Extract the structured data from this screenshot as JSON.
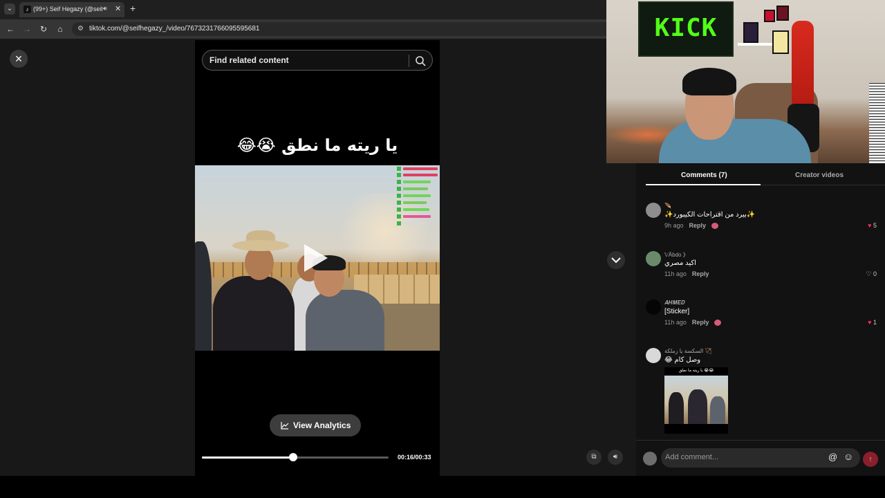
{
  "browser": {
    "tab_title": "(99+) Seif Hegazy (@seifheg",
    "tab_favicon": "tiktok-icon",
    "url": "tiktok.com/@seifhegazy_/video/7673231766095595681"
  },
  "search": {
    "placeholder": "Find related content"
  },
  "video": {
    "caption": "يا ريته ما نطق 😭😂",
    "analytics_label": "View Analytics",
    "time": "00:16/00:33",
    "progress": 0.49
  },
  "webcam": {
    "sign_text": "KICK"
  },
  "comments": {
    "tabs": [
      {
        "label": "Comments (7)",
        "active": true
      },
      {
        "label": "Creator videos",
        "active": false
      }
    ],
    "reply_label": "Reply",
    "items": [
      {
        "user": "🪶",
        "text": "✨بيرد من اقتراحات الكيبورد✨",
        "time": "9h ago",
        "likes": "5",
        "liked": true
      },
      {
        "user": "𝕍Ābdo 》",
        "text": "اكيد مصري",
        "time": "11h ago",
        "likes": "0",
        "liked": false
      },
      {
        "user": "𝑨𝑯𝑴𝑬𝑫",
        "text": "[Sticker]",
        "time": "11h ago",
        "likes": "1",
        "liked": true
      },
      {
        "user": "السكسة يا زملكة 🏹",
        "text": "😂 وصل كام",
        "thumb_caption": "يا ريته ما نطق 😭😂"
      }
    ],
    "input_placeholder": "Add comment..."
  },
  "colors": {
    "accent": "#fe2c55",
    "kick_green": "#53fc18"
  }
}
